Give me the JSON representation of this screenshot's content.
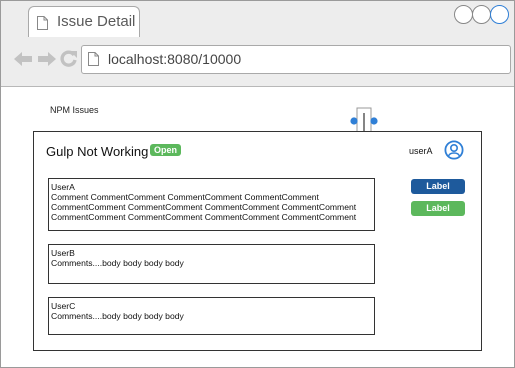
{
  "browser": {
    "tab_title": "Issue Detail",
    "url": "localhost:8080/10000"
  },
  "page": {
    "title": "NPM Issues"
  },
  "issue": {
    "title": "Gulp Not Working",
    "status": "Open",
    "status_color": "#5cb85c",
    "user": "userA",
    "labels": [
      {
        "text": "Label",
        "color": "#1e5a9c"
      },
      {
        "text": "Label",
        "color": "#5cb85c"
      }
    ],
    "comments": [
      {
        "author": "UserA",
        "body": "Comment CommentComment CommentComment CommentComment\nCommentComment CommentComment CommentComment CommentComment\nCommentComment CommentComment CommentComment CommentComment"
      },
      {
        "author": "UserB",
        "body": "Comments....body body body body"
      },
      {
        "author": "UserC",
        "body": "Comments....body body body body"
      }
    ]
  },
  "icons": {
    "tab": "document-icon",
    "back": "back-arrow-icon",
    "forward": "forward-arrow-icon",
    "reload": "reload-icon",
    "url": "document-icon",
    "user": "user-avatar-icon",
    "slider": "slider-icon"
  }
}
